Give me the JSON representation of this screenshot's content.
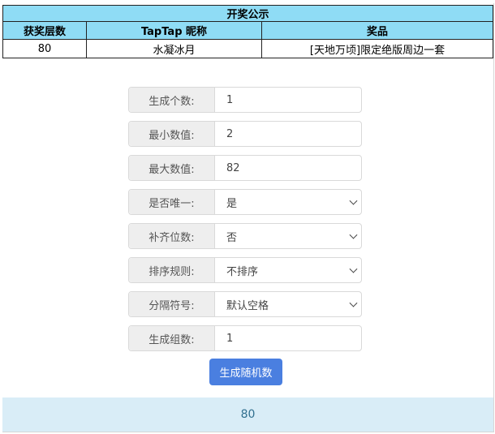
{
  "announcement": {
    "title": "开奖公示",
    "columns": [
      "获奖层数",
      "TapTap 昵称",
      "奖品"
    ],
    "rows": [
      [
        "80",
        "水凝冰月",
        "[天地万顷]限定绝版周边一套"
      ]
    ]
  },
  "form": {
    "count": {
      "label": "生成个数:",
      "value": "1"
    },
    "min": {
      "label": "最小数值:",
      "value": "2"
    },
    "max": {
      "label": "最大数值:",
      "value": "82"
    },
    "unique": {
      "label": "是否唯一:",
      "value": "是"
    },
    "pad": {
      "label": "补齐位数:",
      "value": "否"
    },
    "sort": {
      "label": "排序规则:",
      "value": "不排序"
    },
    "separator": {
      "label": "分隔符号:",
      "value": "默认空格"
    },
    "groups": {
      "label": "生成组数:",
      "value": "1"
    }
  },
  "generate_button": "生成随机数",
  "result": "80",
  "colors": {
    "header": "#8fdcf5",
    "button": "#4a7fe0",
    "result_bg": "#d9edf7"
  }
}
